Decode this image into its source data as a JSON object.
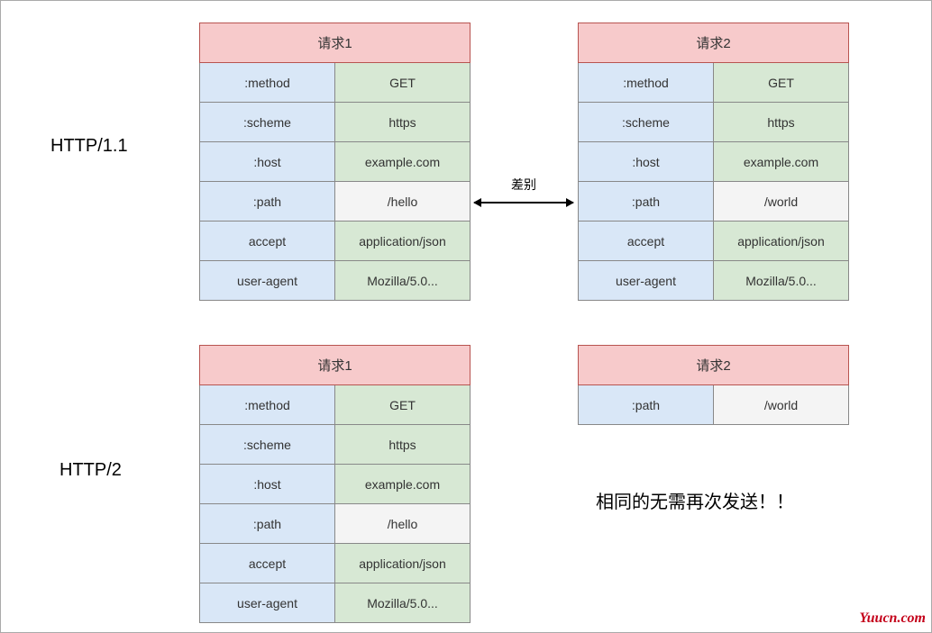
{
  "labels": {
    "http11": "HTTP/1.1",
    "http2": "HTTP/2",
    "diff": "差别",
    "note": "相同的无需再次发送！！",
    "watermark": "Yuucn.com"
  },
  "req11_1": {
    "title": "请求1",
    "rows": [
      {
        "k": ":method",
        "v": "GET",
        "gray": false
      },
      {
        "k": ":scheme",
        "v": "https",
        "gray": false
      },
      {
        "k": ":host",
        "v": "example.com",
        "gray": false
      },
      {
        "k": ":path",
        "v": "/hello",
        "gray": true
      },
      {
        "k": "accept",
        "v": "application/json",
        "gray": false
      },
      {
        "k": "user-agent",
        "v": "Mozilla/5.0...",
        "gray": false
      }
    ]
  },
  "req11_2": {
    "title": "请求2",
    "rows": [
      {
        "k": ":method",
        "v": "GET",
        "gray": false
      },
      {
        "k": ":scheme",
        "v": "https",
        "gray": false
      },
      {
        "k": ":host",
        "v": "example.com",
        "gray": false
      },
      {
        "k": ":path",
        "v": "/world",
        "gray": true
      },
      {
        "k": "accept",
        "v": "application/json",
        "gray": false
      },
      {
        "k": "user-agent",
        "v": "Mozilla/5.0...",
        "gray": false
      }
    ]
  },
  "req2_1": {
    "title": "请求1",
    "rows": [
      {
        "k": ":method",
        "v": "GET",
        "gray": false
      },
      {
        "k": ":scheme",
        "v": "https",
        "gray": false
      },
      {
        "k": ":host",
        "v": "example.com",
        "gray": false
      },
      {
        "k": ":path",
        "v": "/hello",
        "gray": true
      },
      {
        "k": "accept",
        "v": "application/json",
        "gray": false
      },
      {
        "k": "user-agent",
        "v": "Mozilla/5.0...",
        "gray": false
      }
    ]
  },
  "req2_2": {
    "title": "请求2",
    "rows": [
      {
        "k": ":path",
        "v": "/world",
        "gray": true
      }
    ]
  }
}
